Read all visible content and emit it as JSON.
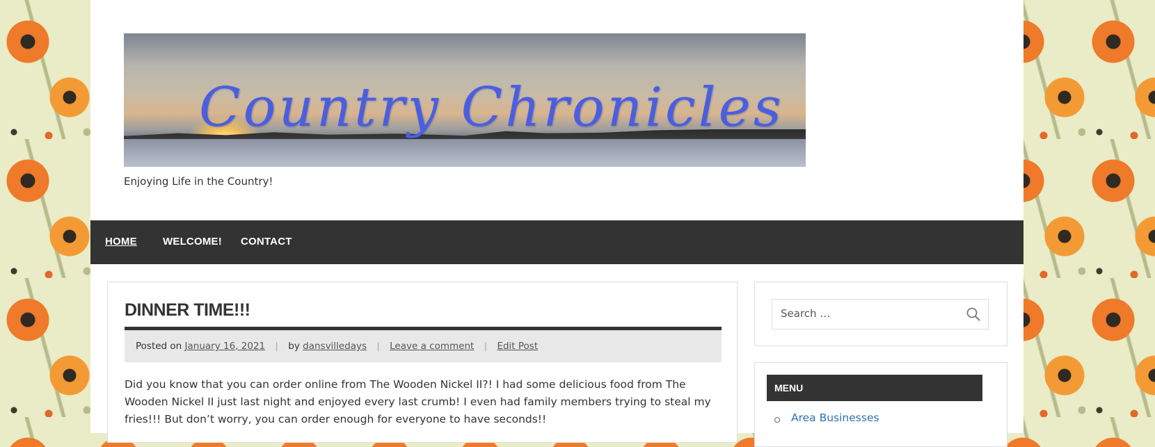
{
  "site": {
    "banner_title": "Country Chronicles",
    "tagline": "Enjoying Life in the Country!"
  },
  "nav": {
    "items": [
      {
        "label": "HOME",
        "active": true
      },
      {
        "label": "WELCOME!",
        "active": false
      },
      {
        "label": "CONTACT",
        "active": false
      }
    ]
  },
  "post": {
    "title": "DINNER TIME!!!",
    "meta": {
      "posted_on_prefix": "Posted on",
      "date": "January 16, 2021",
      "by_prefix": "by",
      "author": "dansvilledays",
      "comment_link": "Leave a comment",
      "edit_link": "Edit Post"
    },
    "body": "Did you know that you can order online from The Wooden Nickel II?! I had some delicious food from The Wooden Nickel II just last night and enjoyed every last crumb! I even had family members trying to steal my fries!!! But don’t worry, you can order enough for everyone to have seconds!!"
  },
  "sidebar": {
    "search": {
      "placeholder": "Search …",
      "icon": "search-icon"
    },
    "menu_widget": {
      "title": "MENU",
      "items": [
        "Area Businesses"
      ]
    }
  },
  "colors": {
    "nav_bg": "#333333",
    "link": "#2e6fb6",
    "banner_text": "#4a5fe0",
    "meta_bg": "#e8e8e8"
  }
}
